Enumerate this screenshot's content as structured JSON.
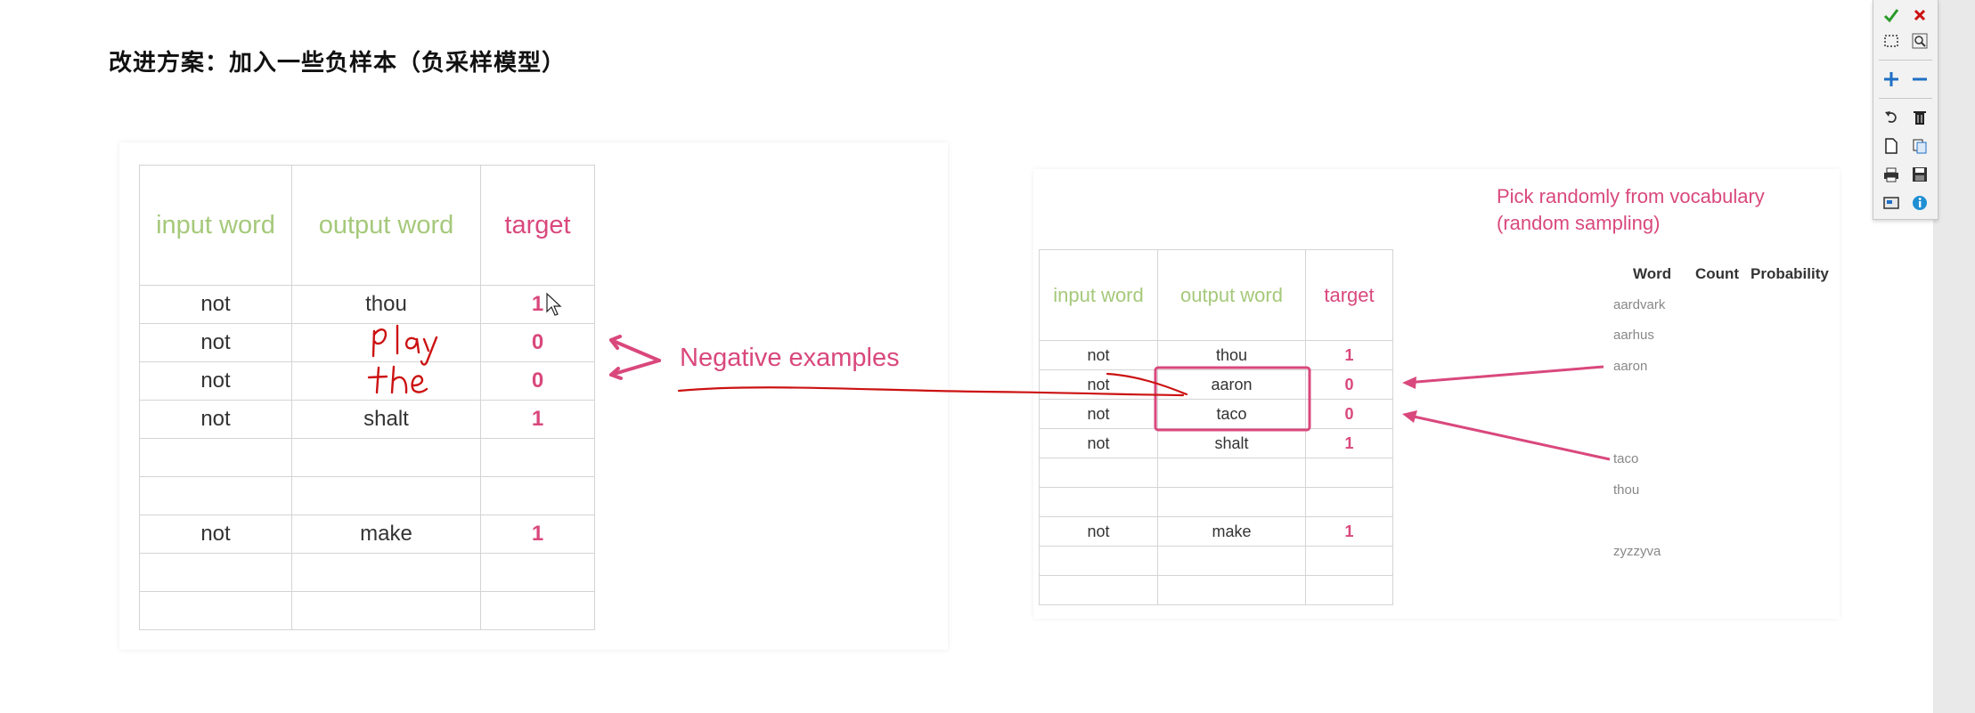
{
  "heading": "改进方案：加入一些负样本（负采样模型）",
  "left_table": {
    "headers": [
      "input word",
      "output word",
      "target"
    ],
    "rows": [
      [
        "not",
        "thou",
        "1"
      ],
      [
        "not",
        "",
        "0"
      ],
      [
        "not",
        "",
        "0"
      ],
      [
        "not",
        "shalt",
        "1"
      ],
      [
        "",
        "",
        ""
      ],
      [
        "",
        "",
        ""
      ],
      [
        "not",
        "make",
        "1"
      ],
      [
        "",
        "",
        ""
      ],
      [
        "",
        "",
        ""
      ]
    ]
  },
  "handwriting": [
    "play",
    "the"
  ],
  "negative_label": "Negative examples",
  "right_table": {
    "headers": [
      "input word",
      "output word",
      "target"
    ],
    "rows": [
      [
        "not",
        "thou",
        "1"
      ],
      [
        "not",
        "aaron",
        "0"
      ],
      [
        "not",
        "taco",
        "0"
      ],
      [
        "not",
        "shalt",
        "1"
      ],
      [
        "",
        "",
        ""
      ],
      [
        "",
        "",
        ""
      ],
      [
        "not",
        "make",
        "1"
      ],
      [
        "",
        "",
        ""
      ],
      [
        "",
        "",
        ""
      ]
    ]
  },
  "vocabulary": {
    "title_line1": "Pick randomly from vocabulary",
    "title_line2": "(random sampling)",
    "headers": [
      "Word",
      "Count",
      "Probability"
    ],
    "words": [
      "aardvark",
      "aarhus",
      "aaron",
      "taco",
      "thou",
      "zyzzyva"
    ]
  },
  "colors": {
    "accent_pink": "#d9487c",
    "header_green": "#a5c97a",
    "handwriting_red": "#cc1111"
  },
  "toolbar_icons": [
    [
      "check-icon",
      "close-icon"
    ],
    [
      "select-region-icon",
      "zoom-icon"
    ],
    [
      "plus-icon",
      "minus-icon"
    ],
    [
      "undo-icon",
      "trash-icon"
    ],
    [
      "new-page-icon",
      "copy-icon"
    ],
    [
      "print-icon",
      "save-icon"
    ],
    [
      "screen-icon",
      "info-icon"
    ]
  ]
}
